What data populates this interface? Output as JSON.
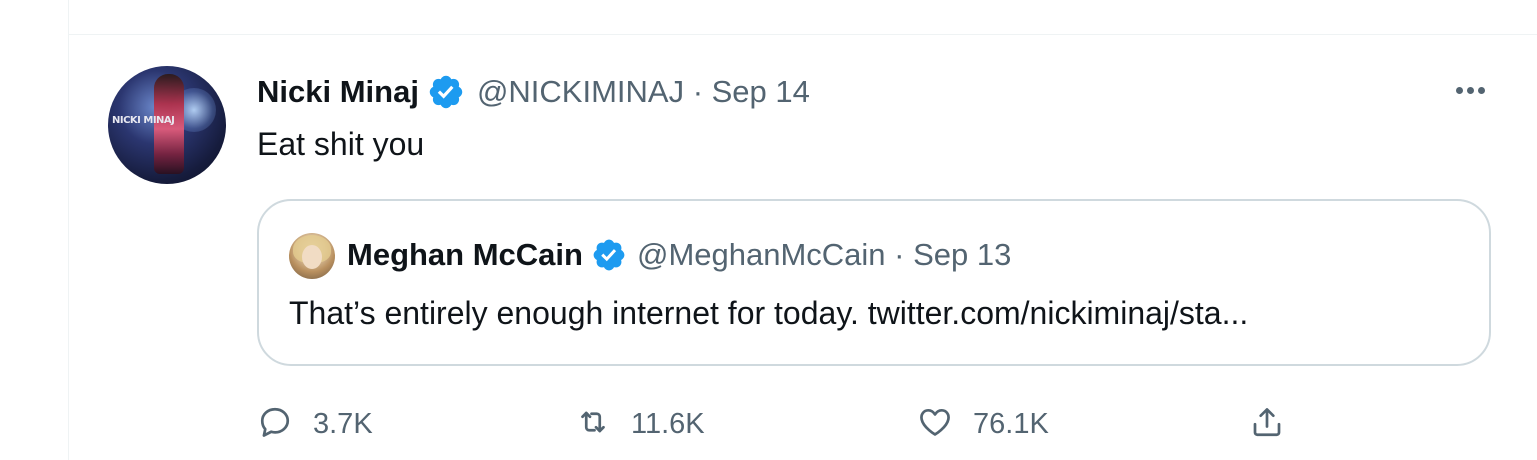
{
  "tweet": {
    "author_name": "Nicki Minaj",
    "handle_time": "@NICKIMINAJ · Sep 14",
    "avatar_text": "NICKI MINAJ",
    "text": "Eat shit you",
    "quoted": {
      "author_name": "Meghan McCain",
      "handle_time": "@MeghanMcCain · Sep 13",
      "text": "That’s entirely enough internet for today. twitter.com/nickiminaj/sta..."
    },
    "actions": {
      "replies": "3.7K",
      "retweets": "11.6K",
      "likes": "76.1K"
    }
  },
  "icons": {
    "verified": "verified-badge-icon",
    "more": "more-icon",
    "reply": "reply-icon",
    "retweet": "retweet-icon",
    "like": "heart-icon",
    "share": "share-icon"
  },
  "colors": {
    "verified_blue": "#1d9bf0",
    "secondary_text": "#536471",
    "border": "#cfd9de"
  }
}
